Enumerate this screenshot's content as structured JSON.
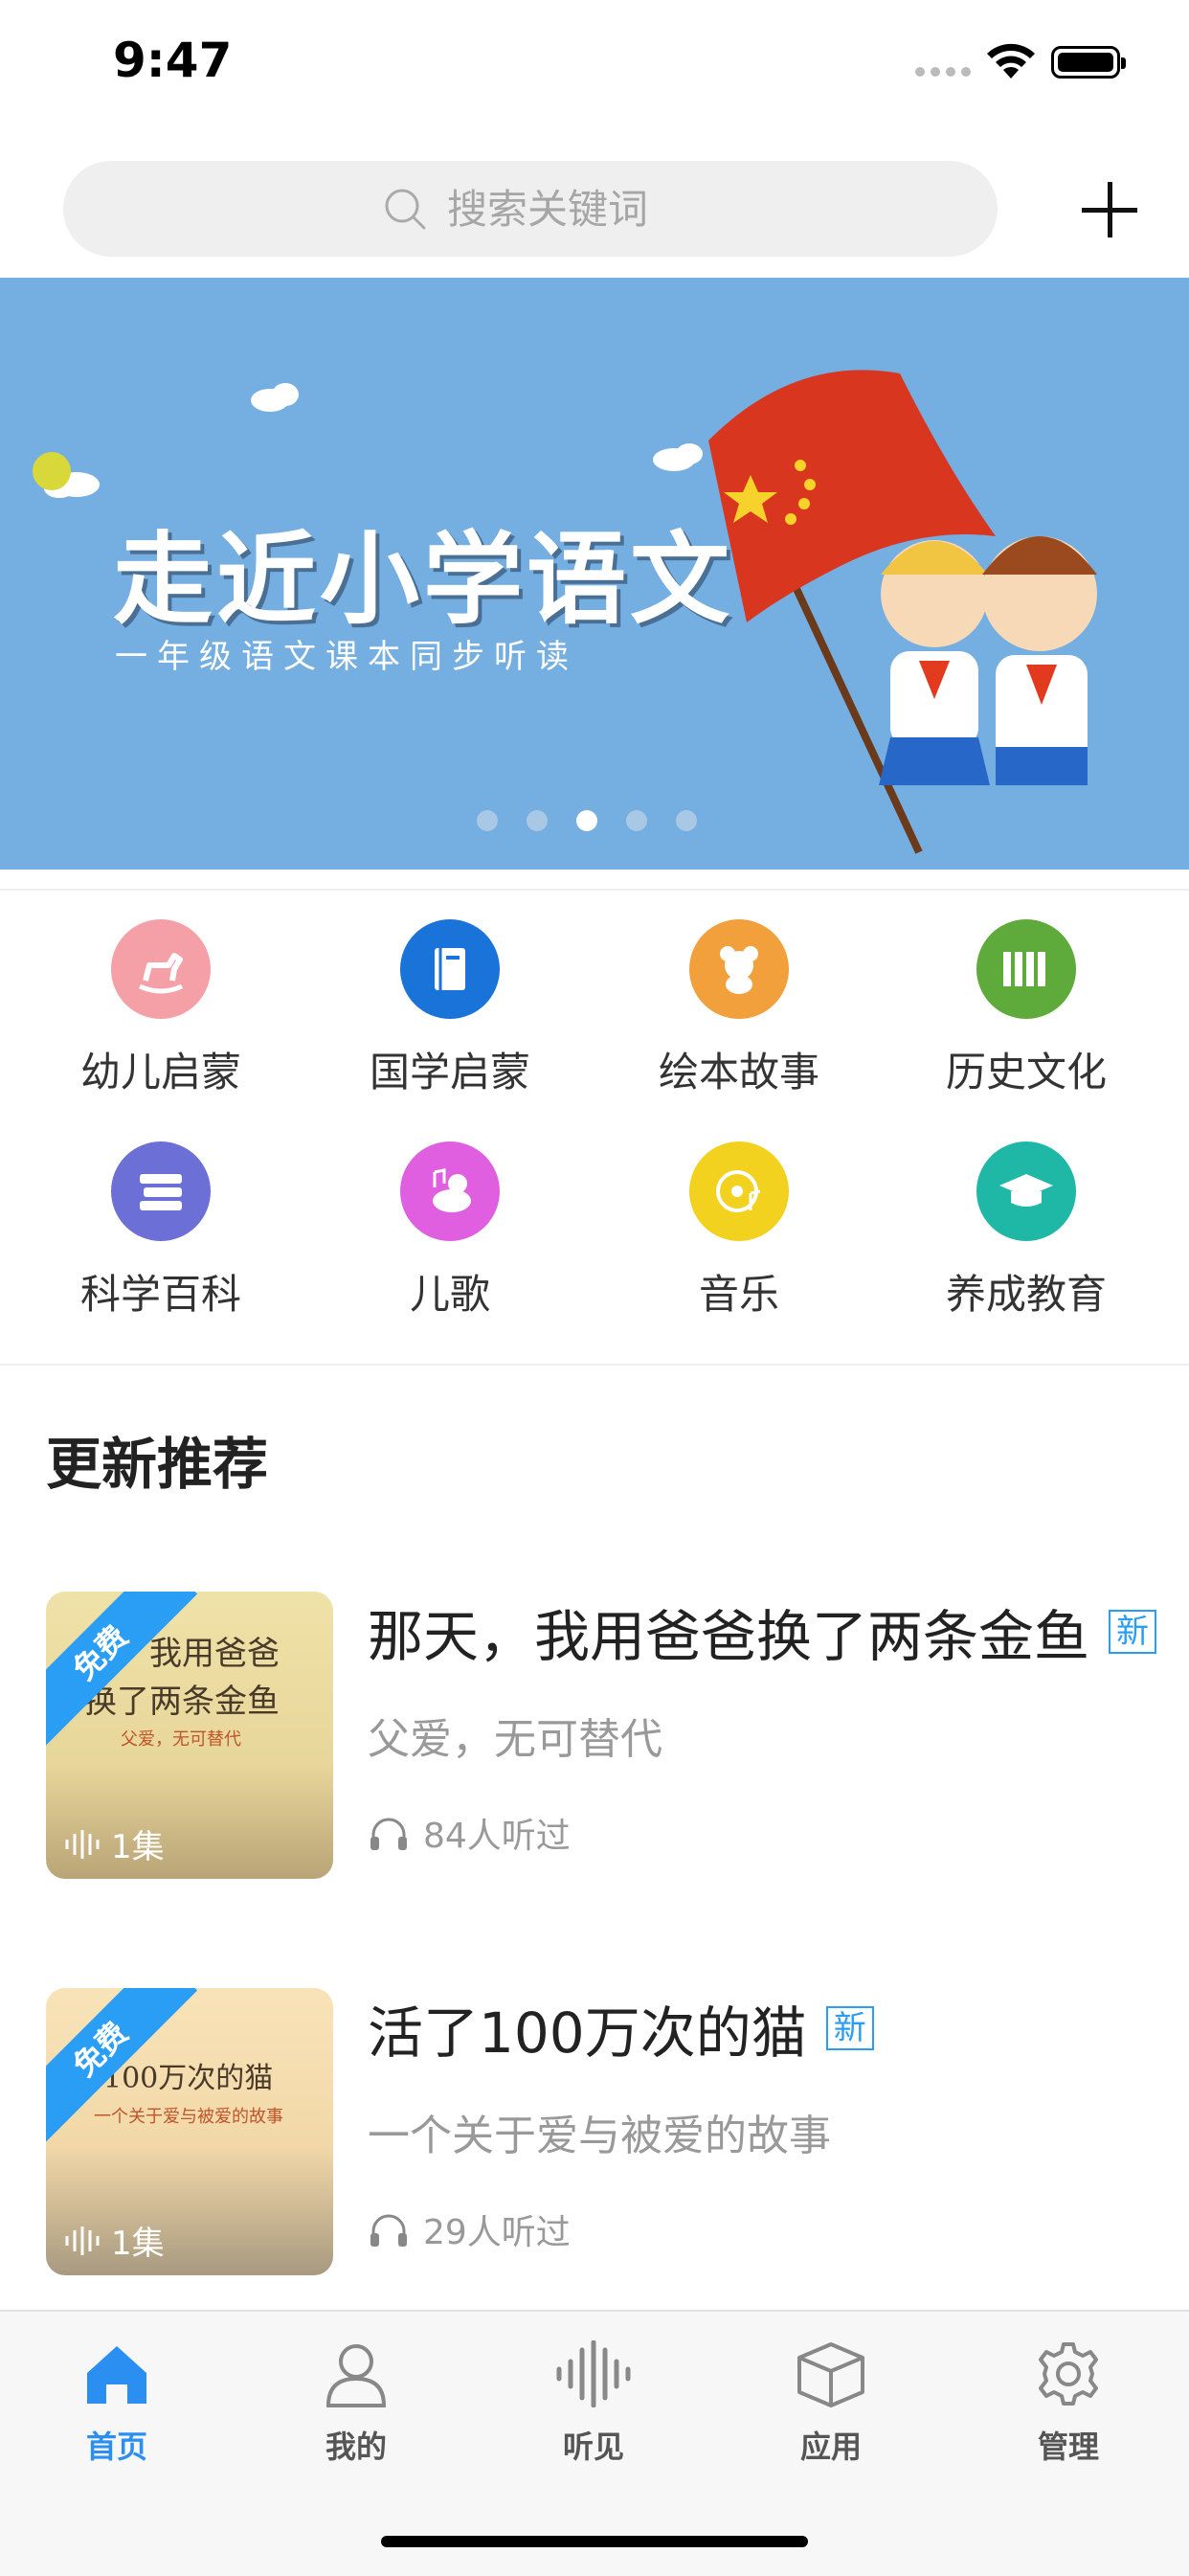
{
  "status_bar": {
    "time": "9:47"
  },
  "search": {
    "placeholder": "搜索关键词"
  },
  "banner": {
    "title": "走近小学语文",
    "subtitle": "一年级语文课本同步听读",
    "page_count": 5,
    "active_page": 3
  },
  "categories": [
    {
      "label": "幼儿启蒙",
      "icon": "rocking-horse-icon",
      "color": "#f4a0a6"
    },
    {
      "label": "国学启蒙",
      "icon": "book-icon",
      "color": "#1a73d9"
    },
    {
      "label": "绘本故事",
      "icon": "bear-icon",
      "color": "#f2a03c"
    },
    {
      "label": "历史文化",
      "icon": "bamboo-slip-icon",
      "color": "#5eaa3a"
    },
    {
      "label": "科学百科",
      "icon": "books-stack-icon",
      "color": "#6b6fd6"
    },
    {
      "label": "儿歌",
      "icon": "duck-music-icon",
      "color": "#e05ee0"
    },
    {
      "label": "音乐",
      "icon": "music-disc-icon",
      "color": "#f2d21e"
    },
    {
      "label": "养成教育",
      "icon": "graduation-cap-icon",
      "color": "#1fb8a6"
    }
  ],
  "section": {
    "title": "更新推荐"
  },
  "items": [
    {
      "title": "那天，我用爸爸换了两条金鱼",
      "new_tag": "新",
      "subtitle": "父爱，无可替代",
      "plays": "84人听过",
      "badge": "免费",
      "episodes": "1集",
      "cover_text": "天，我用爸爸\n换了两条金鱼",
      "cover_sub": "父爱，无可替代"
    },
    {
      "title": "活了100万次的猫",
      "new_tag": "新",
      "subtitle": "一个关于爱与被爱的故事",
      "plays": "29人听过",
      "badge": "免费",
      "episodes": "1集",
      "cover_text": "了100万次的猫",
      "cover_sub": "一个关于爱与被爱的故事"
    }
  ],
  "tabs": [
    {
      "label": "首页",
      "icon": "home-icon",
      "active": true
    },
    {
      "label": "我的",
      "icon": "person-icon",
      "active": false
    },
    {
      "label": "听见",
      "icon": "soundwave-icon",
      "active": false
    },
    {
      "label": "应用",
      "icon": "cube-icon",
      "active": false
    },
    {
      "label": "管理",
      "icon": "gear-icon",
      "active": false
    }
  ],
  "colors": {
    "accent": "#2a8ff0",
    "banner_bg": "#75aee1",
    "badge": "#2a9df4"
  }
}
